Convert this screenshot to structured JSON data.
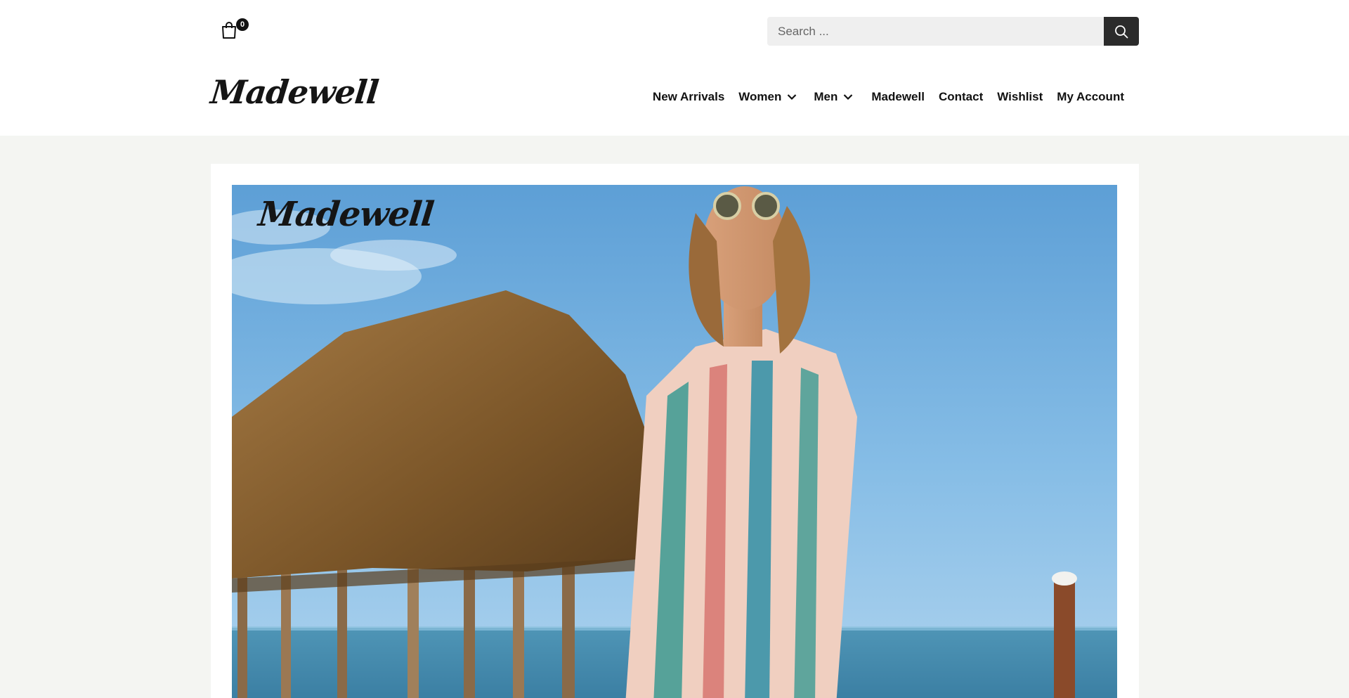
{
  "cart": {
    "count": "0",
    "icon": "shopping-bag-icon"
  },
  "search": {
    "placeholder": "Search ...",
    "icon": "search-icon"
  },
  "brand": {
    "logo_text": "Madewell"
  },
  "nav": {
    "items": [
      {
        "label": "New Arrivals",
        "dropdown": false
      },
      {
        "label": "Women",
        "dropdown": true
      },
      {
        "label": "Men",
        "dropdown": true
      },
      {
        "label": "Madewell",
        "dropdown": false
      },
      {
        "label": "Contact",
        "dropdown": false
      },
      {
        "label": "Wishlist",
        "dropdown": false
      },
      {
        "label": "My Account",
        "dropdown": false
      }
    ]
  },
  "hero": {
    "logo_text": "Madewell"
  },
  "colors": {
    "page_bg": "#f4f5f2",
    "header_bg": "#ffffff",
    "search_bg": "#efefef",
    "search_button": "#2b2b2b",
    "text": "#111111"
  }
}
